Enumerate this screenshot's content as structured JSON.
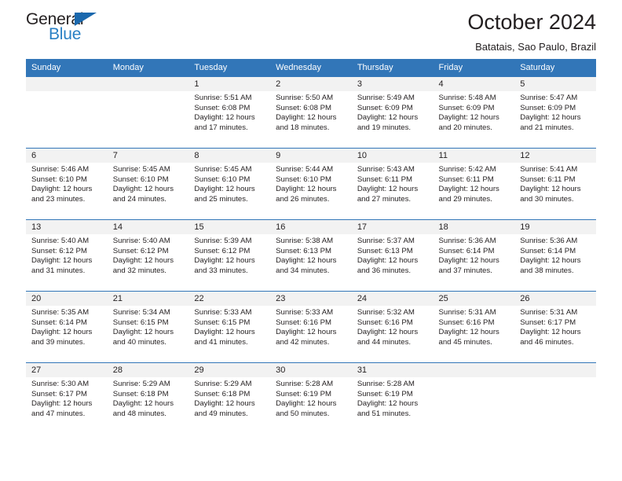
{
  "logo": {
    "line1": "General",
    "line2": "Blue",
    "triangle_icon": "triangle-icon",
    "colors": {
      "text": "#231f20",
      "blue": "#2980c4",
      "triangle": "#1a68ad"
    }
  },
  "header": {
    "title": "October 2024",
    "subtitle": "Batatais, Sao Paulo, Brazil"
  },
  "theme": {
    "header_bg": "#3276b8",
    "daynum_bg": "#f2f2f2",
    "row_border": "#3276b8"
  },
  "weekdays": [
    "Sunday",
    "Monday",
    "Tuesday",
    "Wednesday",
    "Thursday",
    "Friday",
    "Saturday"
  ],
  "weeks": [
    [
      {
        "day": "",
        "blank": true
      },
      {
        "day": "",
        "blank": true
      },
      {
        "day": "1",
        "sunrise": "Sunrise: 5:51 AM",
        "sunset": "Sunset: 6:08 PM",
        "daylight": "Daylight: 12 hours and 17 minutes."
      },
      {
        "day": "2",
        "sunrise": "Sunrise: 5:50 AM",
        "sunset": "Sunset: 6:08 PM",
        "daylight": "Daylight: 12 hours and 18 minutes."
      },
      {
        "day": "3",
        "sunrise": "Sunrise: 5:49 AM",
        "sunset": "Sunset: 6:09 PM",
        "daylight": "Daylight: 12 hours and 19 minutes."
      },
      {
        "day": "4",
        "sunrise": "Sunrise: 5:48 AM",
        "sunset": "Sunset: 6:09 PM",
        "daylight": "Daylight: 12 hours and 20 minutes."
      },
      {
        "day": "5",
        "sunrise": "Sunrise: 5:47 AM",
        "sunset": "Sunset: 6:09 PM",
        "daylight": "Daylight: 12 hours and 21 minutes."
      }
    ],
    [
      {
        "day": "6",
        "sunrise": "Sunrise: 5:46 AM",
        "sunset": "Sunset: 6:10 PM",
        "daylight": "Daylight: 12 hours and 23 minutes."
      },
      {
        "day": "7",
        "sunrise": "Sunrise: 5:45 AM",
        "sunset": "Sunset: 6:10 PM",
        "daylight": "Daylight: 12 hours and 24 minutes."
      },
      {
        "day": "8",
        "sunrise": "Sunrise: 5:45 AM",
        "sunset": "Sunset: 6:10 PM",
        "daylight": "Daylight: 12 hours and 25 minutes."
      },
      {
        "day": "9",
        "sunrise": "Sunrise: 5:44 AM",
        "sunset": "Sunset: 6:10 PM",
        "daylight": "Daylight: 12 hours and 26 minutes."
      },
      {
        "day": "10",
        "sunrise": "Sunrise: 5:43 AM",
        "sunset": "Sunset: 6:11 PM",
        "daylight": "Daylight: 12 hours and 27 minutes."
      },
      {
        "day": "11",
        "sunrise": "Sunrise: 5:42 AM",
        "sunset": "Sunset: 6:11 PM",
        "daylight": "Daylight: 12 hours and 29 minutes."
      },
      {
        "day": "12",
        "sunrise": "Sunrise: 5:41 AM",
        "sunset": "Sunset: 6:11 PM",
        "daylight": "Daylight: 12 hours and 30 minutes."
      }
    ],
    [
      {
        "day": "13",
        "sunrise": "Sunrise: 5:40 AM",
        "sunset": "Sunset: 6:12 PM",
        "daylight": "Daylight: 12 hours and 31 minutes."
      },
      {
        "day": "14",
        "sunrise": "Sunrise: 5:40 AM",
        "sunset": "Sunset: 6:12 PM",
        "daylight": "Daylight: 12 hours and 32 minutes."
      },
      {
        "day": "15",
        "sunrise": "Sunrise: 5:39 AM",
        "sunset": "Sunset: 6:12 PM",
        "daylight": "Daylight: 12 hours and 33 minutes."
      },
      {
        "day": "16",
        "sunrise": "Sunrise: 5:38 AM",
        "sunset": "Sunset: 6:13 PM",
        "daylight": "Daylight: 12 hours and 34 minutes."
      },
      {
        "day": "17",
        "sunrise": "Sunrise: 5:37 AM",
        "sunset": "Sunset: 6:13 PM",
        "daylight": "Daylight: 12 hours and 36 minutes."
      },
      {
        "day": "18",
        "sunrise": "Sunrise: 5:36 AM",
        "sunset": "Sunset: 6:14 PM",
        "daylight": "Daylight: 12 hours and 37 minutes."
      },
      {
        "day": "19",
        "sunrise": "Sunrise: 5:36 AM",
        "sunset": "Sunset: 6:14 PM",
        "daylight": "Daylight: 12 hours and 38 minutes."
      }
    ],
    [
      {
        "day": "20",
        "sunrise": "Sunrise: 5:35 AM",
        "sunset": "Sunset: 6:14 PM",
        "daylight": "Daylight: 12 hours and 39 minutes."
      },
      {
        "day": "21",
        "sunrise": "Sunrise: 5:34 AM",
        "sunset": "Sunset: 6:15 PM",
        "daylight": "Daylight: 12 hours and 40 minutes."
      },
      {
        "day": "22",
        "sunrise": "Sunrise: 5:33 AM",
        "sunset": "Sunset: 6:15 PM",
        "daylight": "Daylight: 12 hours and 41 minutes."
      },
      {
        "day": "23",
        "sunrise": "Sunrise: 5:33 AM",
        "sunset": "Sunset: 6:16 PM",
        "daylight": "Daylight: 12 hours and 42 minutes."
      },
      {
        "day": "24",
        "sunrise": "Sunrise: 5:32 AM",
        "sunset": "Sunset: 6:16 PM",
        "daylight": "Daylight: 12 hours and 44 minutes."
      },
      {
        "day": "25",
        "sunrise": "Sunrise: 5:31 AM",
        "sunset": "Sunset: 6:16 PM",
        "daylight": "Daylight: 12 hours and 45 minutes."
      },
      {
        "day": "26",
        "sunrise": "Sunrise: 5:31 AM",
        "sunset": "Sunset: 6:17 PM",
        "daylight": "Daylight: 12 hours and 46 minutes."
      }
    ],
    [
      {
        "day": "27",
        "sunrise": "Sunrise: 5:30 AM",
        "sunset": "Sunset: 6:17 PM",
        "daylight": "Daylight: 12 hours and 47 minutes."
      },
      {
        "day": "28",
        "sunrise": "Sunrise: 5:29 AM",
        "sunset": "Sunset: 6:18 PM",
        "daylight": "Daylight: 12 hours and 48 minutes."
      },
      {
        "day": "29",
        "sunrise": "Sunrise: 5:29 AM",
        "sunset": "Sunset: 6:18 PM",
        "daylight": "Daylight: 12 hours and 49 minutes."
      },
      {
        "day": "30",
        "sunrise": "Sunrise: 5:28 AM",
        "sunset": "Sunset: 6:19 PM",
        "daylight": "Daylight: 12 hours and 50 minutes."
      },
      {
        "day": "31",
        "sunrise": "Sunrise: 5:28 AM",
        "sunset": "Sunset: 6:19 PM",
        "daylight": "Daylight: 12 hours and 51 minutes."
      },
      {
        "day": "",
        "blank": true
      },
      {
        "day": "",
        "blank": true
      }
    ]
  ]
}
